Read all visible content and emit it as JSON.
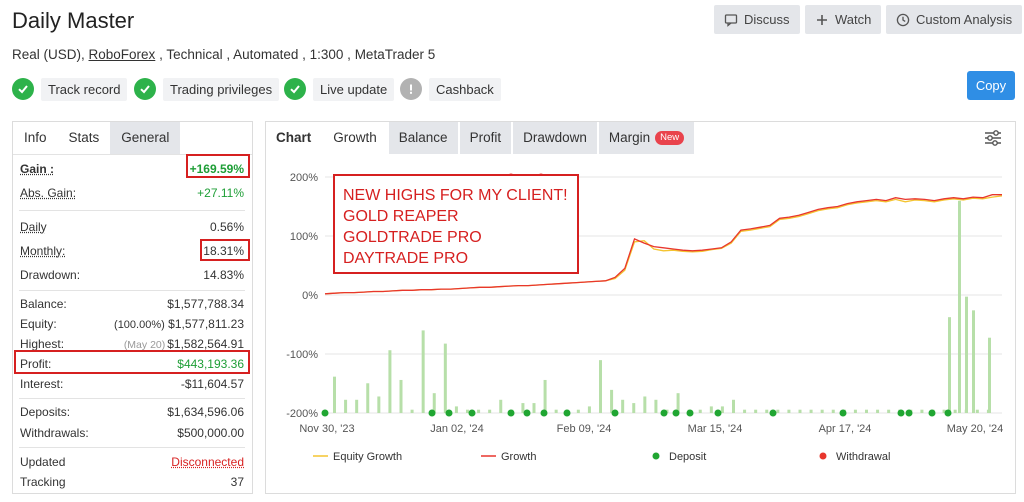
{
  "header": {
    "title": "Daily Master",
    "subtitle_prefix": "Real (USD), ",
    "broker": "RoboForex",
    "subtitle_suffix": " , Technical , Automated , 1:300 , MetaTrader 5"
  },
  "actions": {
    "discuss": "Discuss",
    "watch": "Watch",
    "custom_analysis": "Custom Analysis",
    "copy": "Copy"
  },
  "badges": [
    {
      "label": "Track record",
      "status": "check"
    },
    {
      "label": "Trading privileges",
      "status": "check"
    },
    {
      "label": "Live update",
      "status": "check"
    },
    {
      "label": "Cashback",
      "status": "info"
    }
  ],
  "stats_tabs": [
    "Info",
    "Stats",
    "General"
  ],
  "stats": {
    "gain": {
      "label": "Gain :",
      "value": "+169.59%"
    },
    "abs_gain": {
      "label": "Abs. Gain:",
      "value": "+27.11%"
    },
    "daily": {
      "label": "Daily",
      "value": "0.56%"
    },
    "monthly": {
      "label": "Monthly:",
      "value": "18.31%"
    },
    "drawdown": {
      "label": "Drawdown:",
      "value": "14.83%"
    },
    "balance": {
      "label": "Balance:",
      "value": "$1,577,788.34"
    },
    "equity": {
      "label": "Equity:",
      "note": "(100.00%)",
      "value": "$1,577,811.23"
    },
    "highest": {
      "label": "Highest:",
      "note": "(May 20)",
      "value": "$1,582,564.91"
    },
    "profit": {
      "label": "Profit:",
      "value": "$443,193.36"
    },
    "interest": {
      "label": "Interest:",
      "value": "-$11,604.57"
    },
    "deposits": {
      "label": "Deposits:",
      "value": "$1,634,596.06"
    },
    "withdrawals": {
      "label": "Withdrawals:",
      "value": "$500,000.00"
    },
    "updated": {
      "label": "Updated",
      "value": "Disconnected"
    },
    "tracking": {
      "label": "Tracking",
      "value": "37"
    }
  },
  "chart_tabs": [
    "Chart",
    "Growth",
    "Balance",
    "Profit",
    "Drawdown",
    "Margin"
  ],
  "new_tag": "New",
  "annotation": [
    "NEW HIGHS FOR MY CLIENT!",
    "GOLD REAPER",
    "GOLDTRADE PRO",
    "DAYTRADE PRO"
  ],
  "colors": {
    "growth": "#e8362d",
    "equity_growth": "#f4c430",
    "bars": "#b7dfa9",
    "deposit": "#20a632",
    "withdrawal": "#e8362d",
    "accent": "#2f8ee5",
    "highlight": "#d62020"
  },
  "chart_data": {
    "type": "line",
    "y_ticks": [
      "200%",
      "100%",
      "0%",
      "-100%",
      "-200%"
    ],
    "x_ticks": [
      "Nov 30, '23",
      "Jan 02, '24",
      "Feb 09, '24",
      "Mar 15, '24",
      "Apr 17, '24",
      "May 20, '24"
    ],
    "ylim": [
      -200,
      200
    ],
    "legend": [
      "Equity Growth",
      "Growth",
      "Deposit",
      "Withdrawal"
    ],
    "series": [
      {
        "name": "Growth",
        "values": [
          2,
          3,
          4,
          4,
          5,
          6,
          6,
          7,
          8,
          8,
          9,
          9,
          10,
          10,
          11,
          12,
          13,
          13,
          14,
          15,
          16,
          16,
          17,
          18,
          19,
          20,
          21,
          22,
          23,
          24,
          30,
          45,
          95,
          88,
          82,
          80,
          78,
          76,
          75,
          76,
          78,
          80,
          90,
          110,
          112,
          115,
          118,
          130,
          132,
          135,
          140,
          145,
          148,
          150,
          155,
          158,
          160,
          162,
          160,
          165,
          162,
          163,
          162,
          160,
          163,
          165,
          163,
          166,
          165,
          170,
          170
        ]
      },
      {
        "name": "Equity Growth",
        "values": [
          2,
          3,
          4,
          4,
          5,
          6,
          6,
          7,
          8,
          8,
          9,
          9,
          10,
          10,
          11,
          12,
          13,
          13,
          14,
          15,
          16,
          16,
          17,
          18,
          19,
          20,
          21,
          22,
          23,
          24,
          28,
          42,
          90,
          92,
          78,
          75,
          76,
          74,
          73,
          74,
          77,
          79,
          88,
          108,
          110,
          113,
          116,
          128,
          130,
          133,
          138,
          143,
          146,
          148,
          153,
          156,
          158,
          160,
          158,
          162,
          158,
          161,
          160,
          158,
          161,
          163,
          161,
          164,
          163,
          166,
          168
        ]
      }
    ],
    "bars_pct": [
      11,
      4,
      4,
      9,
      5,
      19,
      10,
      1,
      25,
      6,
      21,
      2,
      1,
      1,
      1,
      4,
      1,
      3,
      3,
      10,
      1,
      1,
      1,
      2,
      16,
      7,
      4,
      3,
      5,
      4,
      1,
      6,
      1,
      1,
      2,
      2,
      4,
      1,
      1,
      1,
      1,
      1,
      1,
      1,
      1,
      1,
      1,
      1,
      1,
      1,
      1,
      1,
      1,
      1,
      1,
      1,
      1,
      1,
      1,
      1
    ],
    "deposit_markers_count": 19,
    "withdrawal_markers_count": 2
  }
}
